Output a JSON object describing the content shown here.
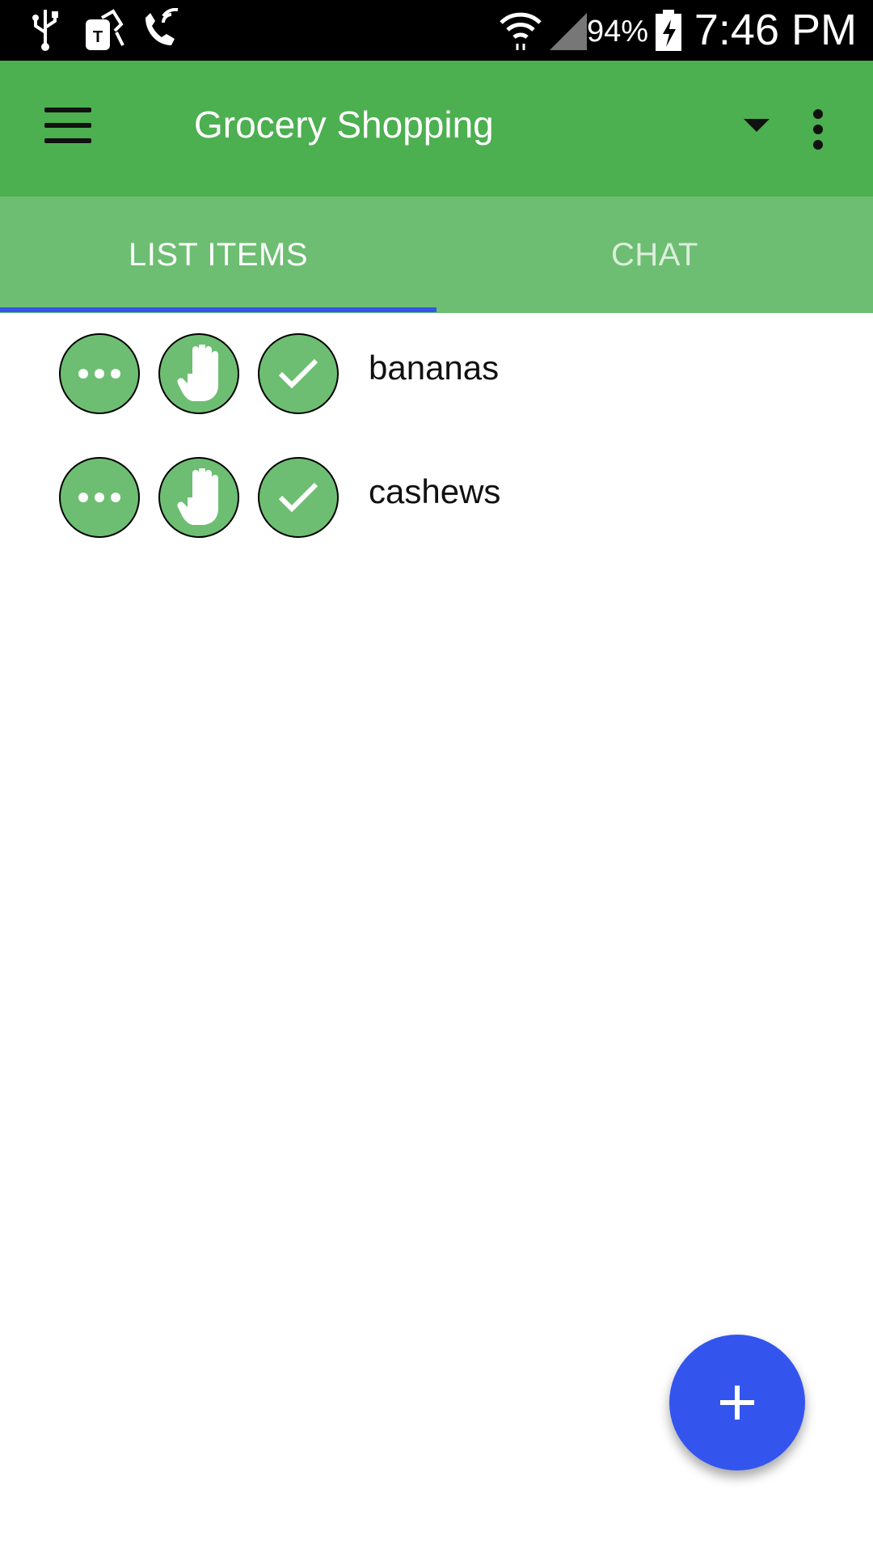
{
  "status_bar": {
    "battery": "94%",
    "time": "7:46 PM",
    "icons": [
      "usb-icon",
      "tmobile-icon",
      "wifi-calling-icon",
      "wifi-icon",
      "signal-icon",
      "battery-charging-icon"
    ]
  },
  "app_bar": {
    "title": "Grocery Shopping",
    "icons": [
      "menu-icon",
      "dropdown-icon",
      "overflow-menu-icon"
    ]
  },
  "tabs": [
    {
      "label": "LIST ITEMS",
      "active": true
    },
    {
      "label": "CHAT",
      "active": false
    }
  ],
  "list": {
    "items": [
      {
        "label": "bananas"
      },
      {
        "label": "cashews"
      }
    ],
    "item_action_icons": [
      "more-icon",
      "hand-icon",
      "check-icon"
    ]
  },
  "fab": {
    "icon": "plus-icon"
  },
  "colors": {
    "app_bar": "#4caf50",
    "tabs": "#6dbe72",
    "indicator": "#3355ee",
    "fab": "#3355ee",
    "item_button": "#6dbe72"
  }
}
